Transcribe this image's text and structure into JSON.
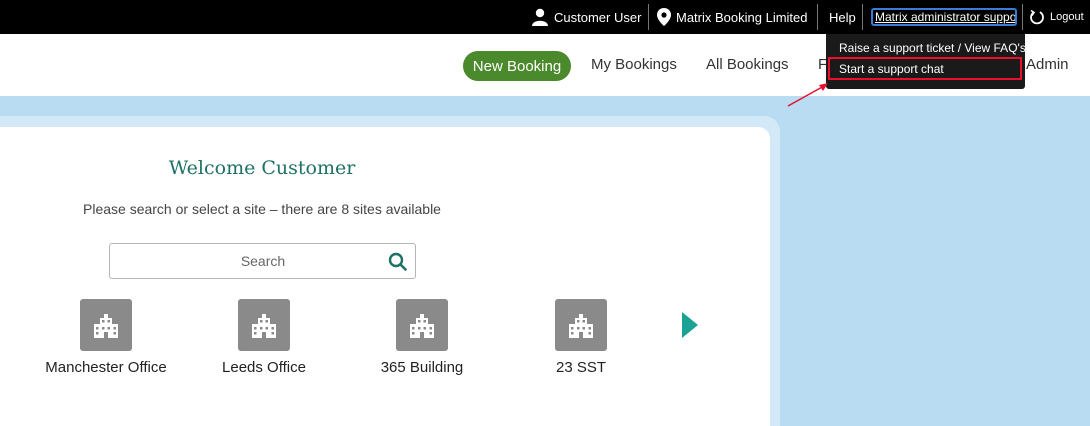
{
  "topbar": {
    "user": "Customer User",
    "organisation": "Matrix Booking Limited",
    "help": "Help",
    "support": "Matrix administrator support",
    "logout": "Logout"
  },
  "nav": {
    "new_booking": "New Booking",
    "my_bookings": "My Bookings",
    "all_bookings": "All Bookings",
    "partial": "F",
    "admin": "Admin"
  },
  "dropdown": {
    "items": [
      "Raise a support ticket / View FAQ's",
      "Start a support chat"
    ]
  },
  "main": {
    "welcome": "Welcome Customer",
    "subtext": "Please search or select a site – there are 8 sites available",
    "search_placeholder": "Search",
    "sites": [
      {
        "label": "Manchester Office"
      },
      {
        "label": "Leeds Office"
      },
      {
        "label": "365 Building"
      },
      {
        "label": "23 SST"
      }
    ]
  },
  "colors": {
    "accent_green": "#4a8a2c",
    "heading_teal": "#1e7164",
    "background_blue": "#b9dcf3",
    "annotation_red": "#e8102c"
  }
}
